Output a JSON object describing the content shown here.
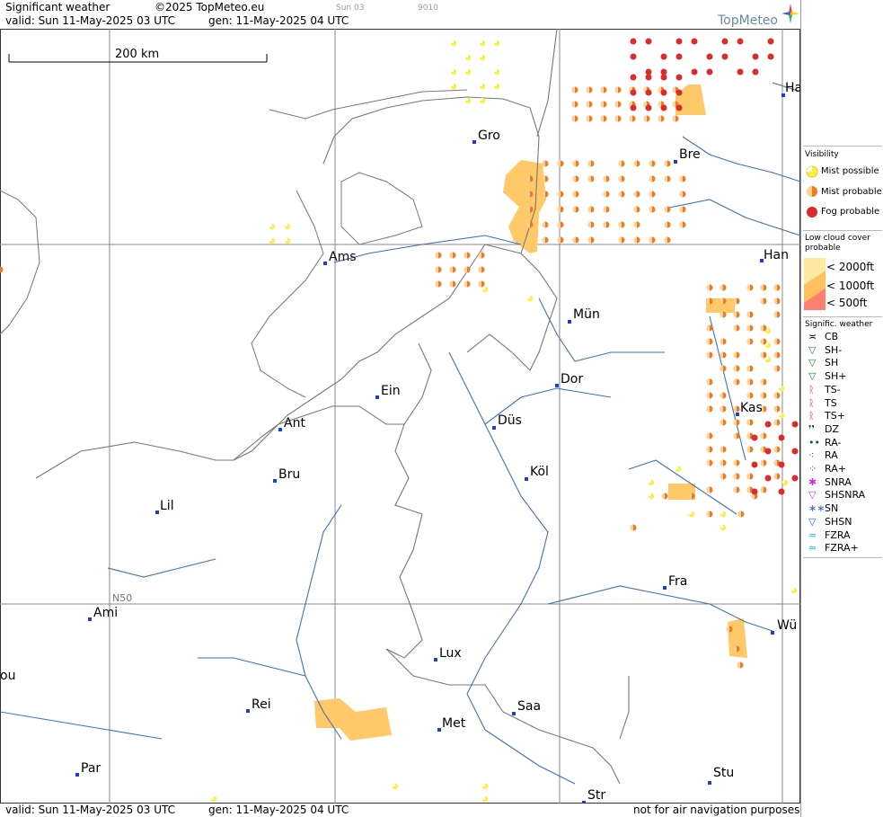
{
  "header": {
    "title": "Significant weather",
    "copyright": "©2025 TopMeteo.eu",
    "valid": "valid:  Sun  11-May-2025  03 UTC",
    "generated": "gen: 11-May-2025 04 UTC",
    "faint_a": "Sun 03",
    "faint_b": "9010",
    "logo": "TopMeteo"
  },
  "footer": {
    "valid": "valid:  Sun  11-May-2025  03 UTC",
    "generated": "gen: 11-May-2025 04 UTC",
    "disclaimer": "not for air navigation purposes"
  },
  "map": {
    "scale_label": "200 km",
    "grid_label": "N50",
    "cities": [
      {
        "name": "Gro"
      },
      {
        "name": "Bre"
      },
      {
        "name": "Ha"
      },
      {
        "name": "Han"
      },
      {
        "name": "Ams"
      },
      {
        "name": "Mün"
      },
      {
        "name": "Dor"
      },
      {
        "name": "Ein"
      },
      {
        "name": "Ant"
      },
      {
        "name": "Düs"
      },
      {
        "name": "Kas"
      },
      {
        "name": "Bru"
      },
      {
        "name": "Köl"
      },
      {
        "name": "Lil"
      },
      {
        "name": "Fra"
      },
      {
        "name": "Ami"
      },
      {
        "name": "Wü"
      },
      {
        "name": "Lux"
      },
      {
        "name": "ou"
      },
      {
        "name": "Rei"
      },
      {
        "name": "Saa"
      },
      {
        "name": "Met"
      },
      {
        "name": "Stu"
      },
      {
        "name": "Par"
      },
      {
        "name": "Str"
      }
    ]
  },
  "legend": {
    "visibility_title": "Visibility",
    "mist_possible": "Mist possible",
    "mist_probable": "Mist probable",
    "fog_probable": "Fog probable",
    "lowcloud_title": "Low cloud cover probable",
    "lc_2000": "< 2000ft",
    "lc_1000": "< 1000ft",
    "lc_500": "<   500ft",
    "sigwx_title": "Signific. weather",
    "items": [
      "CB",
      "SH-",
      "SH",
      "SH+",
      "TS-",
      "TS",
      "TS+",
      "DZ",
      "RA-",
      "RA",
      "RA+",
      "SNRA",
      "SHSNRA",
      "SN",
      "SHSN",
      "FZRA",
      "FZRA+"
    ],
    "colors": {
      "mist_possible": "#ffee44",
      "mist_probable": "#f07a20",
      "fog_probable": "#dd2a2a",
      "lowcloud_2000": "#ffe9a0",
      "lowcloud_1000": "#ffc060",
      "lowcloud_500": "#ff8070"
    }
  }
}
